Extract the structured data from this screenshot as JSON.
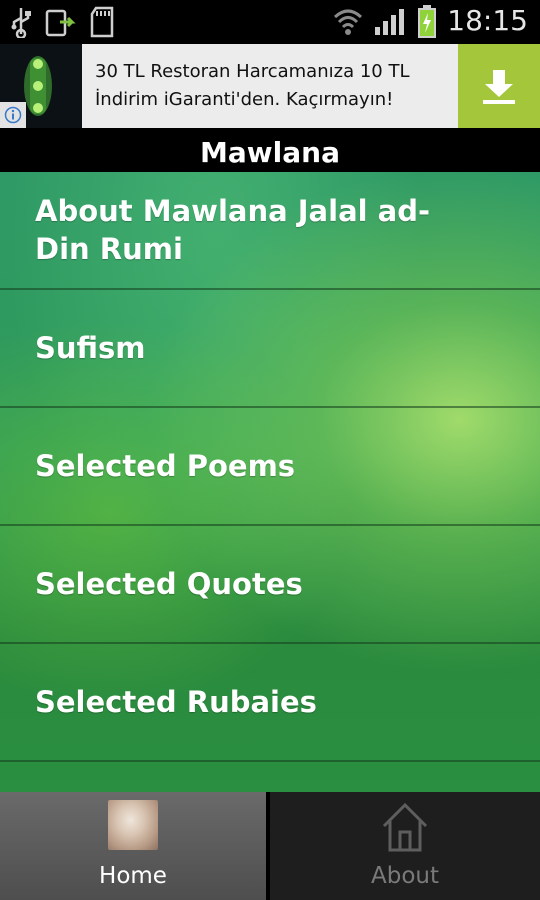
{
  "status_bar": {
    "time": "18:15",
    "icons_left": [
      "usb-icon",
      "screen-share-icon",
      "sd-card-icon"
    ],
    "icons_right": [
      "wifi-icon",
      "signal-icon",
      "battery-icon"
    ]
  },
  "ad": {
    "text": "30 TL Restoran Harcamanıza 10 TL İndirim iGaranti'den. Kaçırmayın!",
    "info_icon": "info-icon",
    "cta_icon": "download-icon",
    "cta_color": "#a4c63a"
  },
  "app": {
    "title": "Mawlana"
  },
  "menu": [
    {
      "label": "About Mawlana Jalal ad-Din Rumi"
    },
    {
      "label": "Sufism"
    },
    {
      "label": "Selected Poems"
    },
    {
      "label": "Selected Quotes"
    },
    {
      "label": "Selected Rubaies"
    }
  ],
  "tabs": [
    {
      "label": "Home",
      "icon": "home-photo-icon",
      "selected": true
    },
    {
      "label": "About",
      "icon": "house-icon",
      "selected": false
    }
  ]
}
